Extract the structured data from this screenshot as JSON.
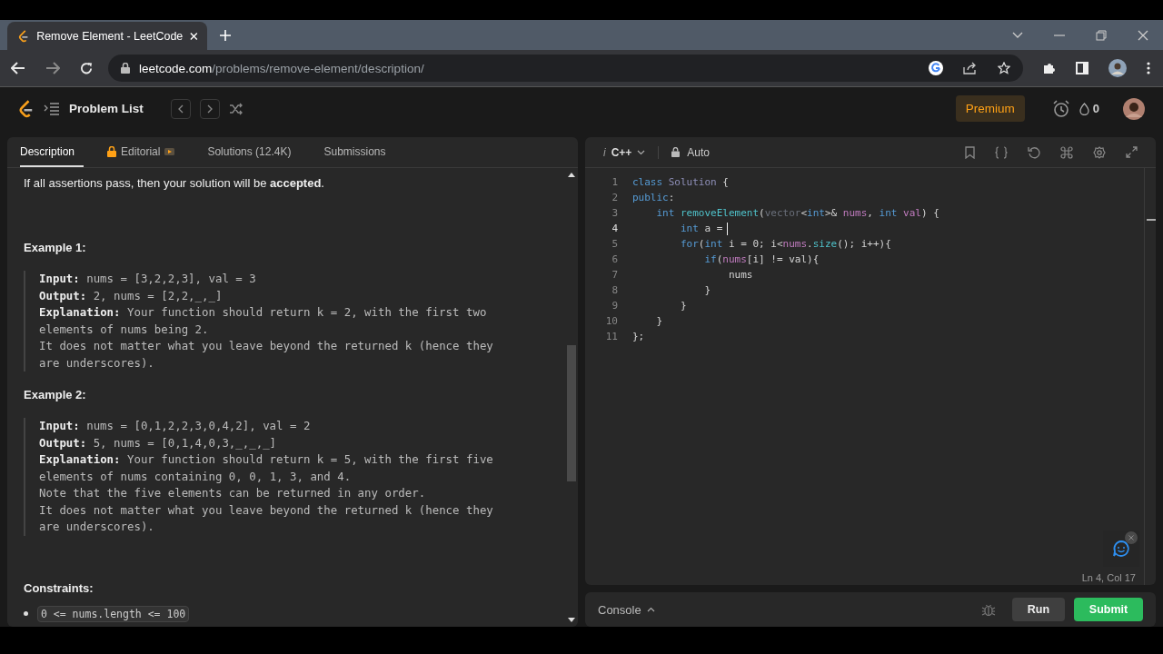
{
  "browser": {
    "tab_title": "Remove Element - LeetCode",
    "url_domain": "leetcode.com",
    "url_path": "/problems/remove-element/description/"
  },
  "nav": {
    "problem_list": "Problem List",
    "premium": "Premium",
    "streak": "0"
  },
  "left_tabs": [
    {
      "label": "Description",
      "selected": true,
      "locked": false
    },
    {
      "label": "Editorial",
      "selected": false,
      "locked": true
    },
    {
      "label": "Solutions (12.4K)",
      "selected": false,
      "locked": false
    },
    {
      "label": "Submissions",
      "selected": false,
      "locked": false
    }
  ],
  "intro": "If all assertions pass, then your solution will be **accepted**.",
  "examples": [
    {
      "title": "Example 1:",
      "lines": [
        {
          "label": "Input:",
          "text": "nums = [3,2,2,3], val = 3"
        },
        {
          "label": "Output:",
          "text": "2, nums = [2,2,_,_]"
        },
        {
          "label": "Explanation:",
          "text": "Your function should return k = 2, with the first two"
        },
        {
          "text": "elements of nums being 2."
        },
        {
          "text": "It does not matter what you leave beyond the returned k (hence they"
        },
        {
          "text": "are underscores)."
        }
      ]
    },
    {
      "title": "Example 2:",
      "lines": [
        {
          "label": "Input:",
          "text": "nums = [0,1,2,2,3,0,4,2], val = 2"
        },
        {
          "label": "Output:",
          "text": "5, nums = [0,1,4,0,3,_,_,_]"
        },
        {
          "label": "Explanation:",
          "text": "Your function should return k = 5, with the first five"
        },
        {
          "text": "elements of nums containing 0, 0, 1, 3, and 4."
        },
        {
          "text": "Note that the five elements can be returned in any order."
        },
        {
          "text": "It does not matter what you leave beyond the returned k (hence they"
        },
        {
          "text": "are underscores)."
        }
      ]
    }
  ],
  "constraints_title": "Constraints:",
  "constraints": [
    "0 <= nums.length <= 100"
  ],
  "editor": {
    "language_prefix": "i",
    "language": "C++",
    "mode": "Auto",
    "status": "Ln 4, Col 17",
    "lines": [
      {
        "num": "1",
        "current": false,
        "tokens": [
          {
            "t": "class",
            "kind": "kw"
          },
          {
            "t": " Solution",
            "kind": "cls"
          },
          {
            "t": " {"
          }
        ]
      },
      {
        "num": "2",
        "current": false,
        "tokens": [
          {
            "t": "public",
            "kind": "kw"
          },
          {
            "t": ":"
          }
        ]
      },
      {
        "num": "3",
        "current": false,
        "tokens": [
          {
            "t": "    int",
            "kind": "kw"
          },
          {
            "t": " removeElement",
            "kind": "fn"
          },
          {
            "t": "("
          },
          {
            "t": "vector",
            "kind": "dim"
          },
          {
            "t": "<"
          },
          {
            "t": "int",
            "kind": "kw"
          },
          {
            "t": ">& "
          },
          {
            "t": "nums",
            "kind": "var"
          },
          {
            "t": ", "
          },
          {
            "t": "int",
            "kind": "kw"
          },
          {
            "t": " val",
            "kind": "var"
          },
          {
            "t": ") {"
          }
        ]
      },
      {
        "num": "4",
        "current": true,
        "tokens": [
          {
            "t": "        int",
            "kind": "kw"
          },
          {
            "t": " a ="
          }
        ]
      },
      {
        "num": "5",
        "current": false,
        "tokens": [
          {
            "t": "        for",
            "kind": "kw"
          },
          {
            "t": "("
          },
          {
            "t": "int",
            "kind": "kw"
          },
          {
            "t": " i = 0; i<"
          },
          {
            "t": "nums",
            "kind": "var"
          },
          {
            "t": "."
          },
          {
            "t": "size",
            "kind": "fn"
          },
          {
            "t": "(); i++){"
          }
        ]
      },
      {
        "num": "6",
        "current": false,
        "tokens": [
          {
            "t": "            if",
            "kind": "kw"
          },
          {
            "t": "("
          },
          {
            "t": "nums",
            "kind": "var"
          },
          {
            "t": "[i] != val){"
          }
        ]
      },
      {
        "num": "7",
        "current": false,
        "tokens": [
          {
            "t": "                nums"
          }
        ]
      },
      {
        "num": "8",
        "current": false,
        "tokens": [
          {
            "t": "            }"
          }
        ]
      },
      {
        "num": "9",
        "current": false,
        "tokens": [
          {
            "t": "        }"
          }
        ]
      },
      {
        "num": "10",
        "current": false,
        "tokens": [
          {
            "t": "    }"
          }
        ]
      },
      {
        "num": "11",
        "current": false,
        "tokens": [
          {
            "t": "};"
          }
        ]
      }
    ]
  },
  "console": {
    "label": "Console",
    "run": "Run",
    "submit": "Submit"
  }
}
